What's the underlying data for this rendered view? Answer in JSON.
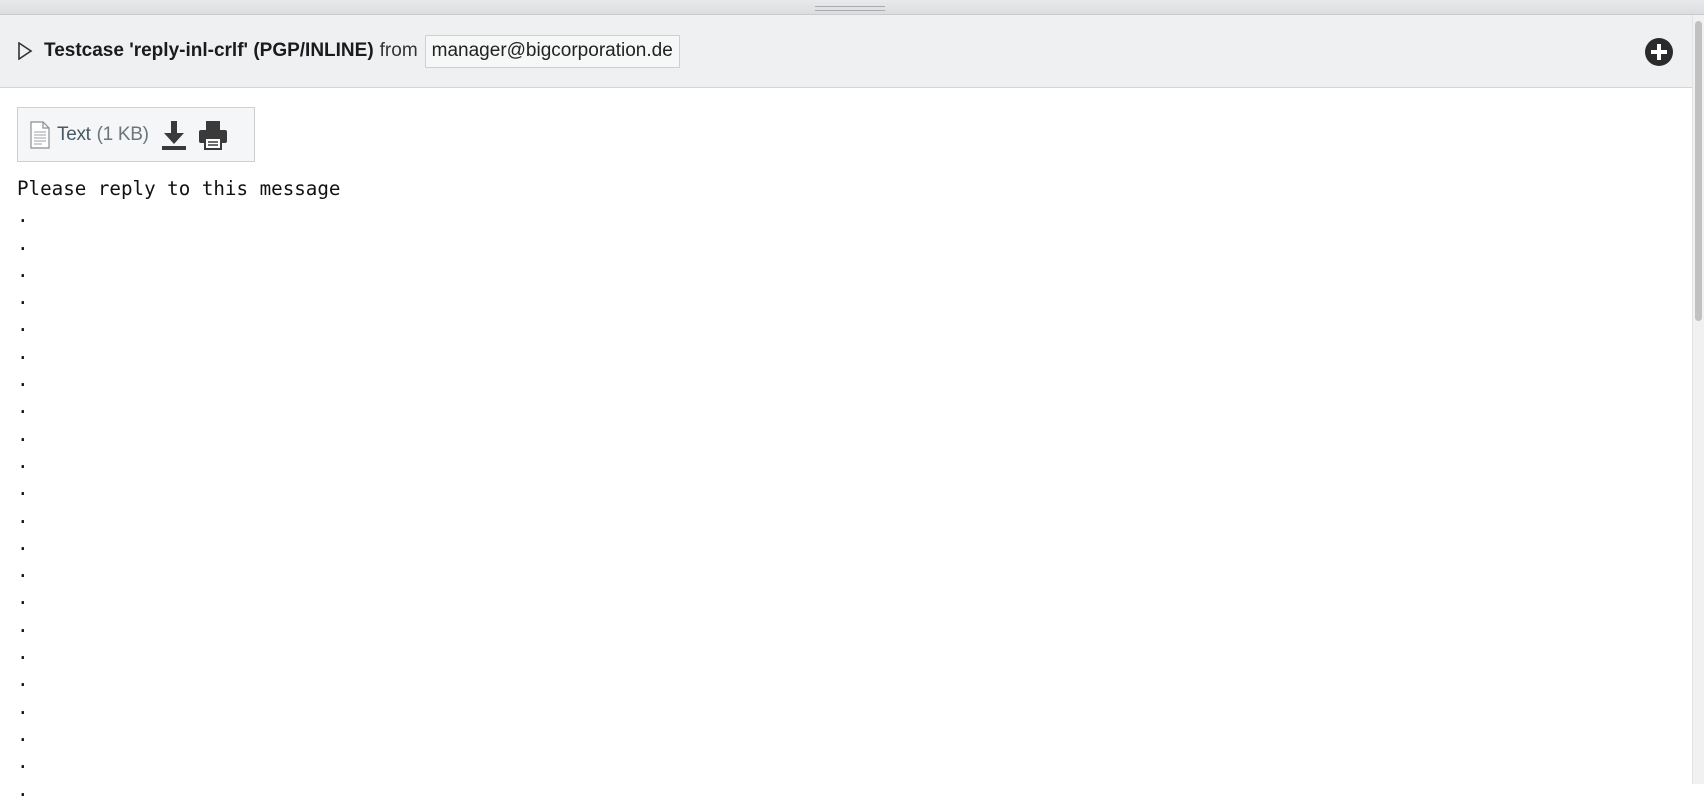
{
  "message": {
    "subject": "Testcase 'reply-inl-crlf' (PGP/INLINE)",
    "from_label": "from",
    "sender": "manager@bigcorporation.de"
  },
  "attachment": {
    "label": "Text",
    "size": "(1 KB)"
  },
  "body": {
    "lines": [
      "Please reply to this message",
      ".",
      ".",
      ".",
      ".",
      ".",
      ".",
      ".",
      ".",
      ".",
      ".",
      ".",
      ".",
      ".",
      ".",
      ".",
      ".",
      ".",
      ".",
      ".",
      ".",
      ".",
      "."
    ]
  },
  "icons": {
    "expand": "triangle-right-icon",
    "add": "plus-circle-icon",
    "document": "text-document-icon",
    "download": "download-icon",
    "print": "printer-icon"
  },
  "colors": {
    "header_bg": "#eef0f1",
    "attachment_text": "#4a5a63"
  }
}
